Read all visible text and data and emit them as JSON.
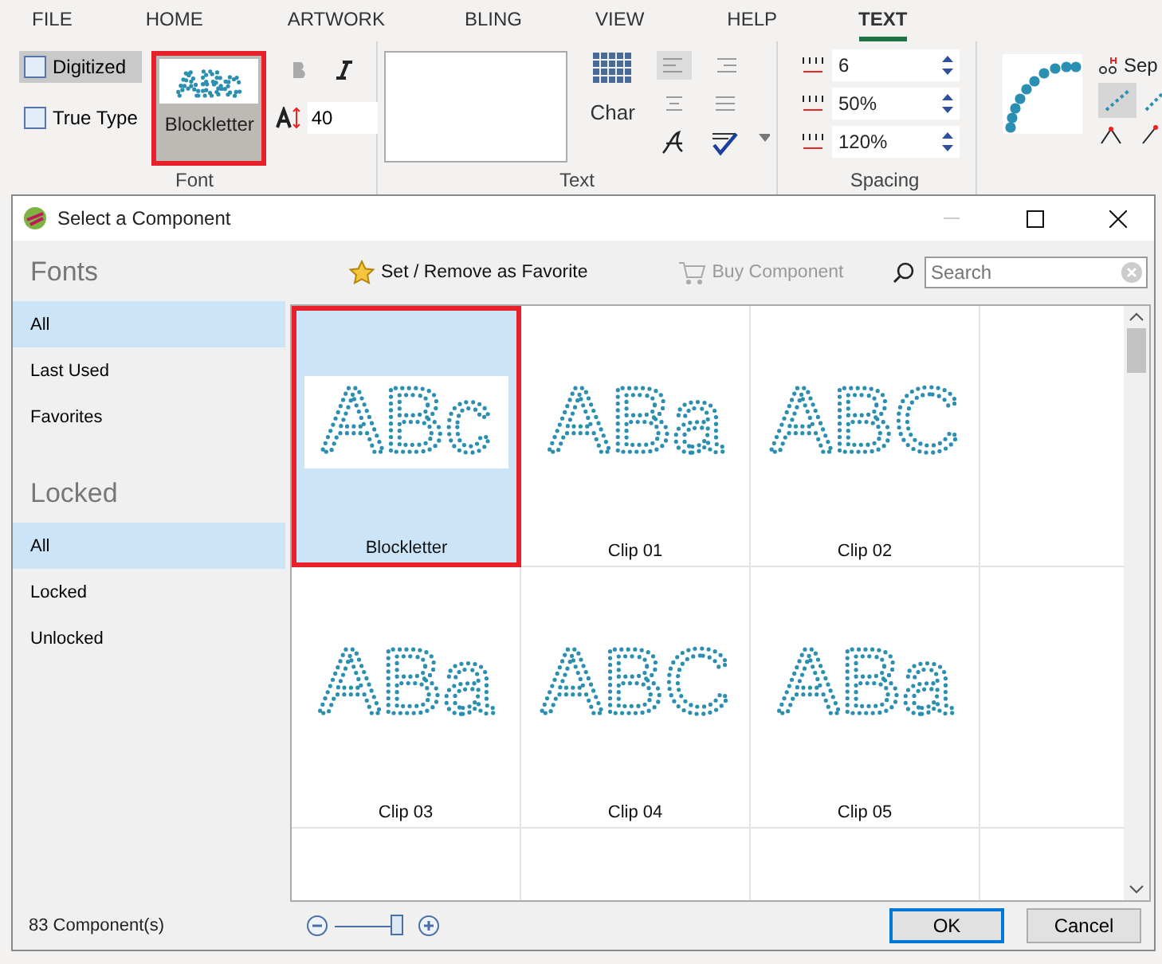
{
  "ribbon": {
    "tabs": [
      {
        "label": "FILE",
        "selected": false
      },
      {
        "label": "HOME",
        "selected": false
      },
      {
        "label": "ARTWORK",
        "selected": false
      },
      {
        "label": "BLING",
        "selected": false
      },
      {
        "label": "VIEW",
        "selected": false
      },
      {
        "label": "HELP",
        "selected": false
      },
      {
        "label": "TEXT",
        "selected": true
      }
    ],
    "font_group": {
      "label": "Font",
      "modes": [
        {
          "label": "Digitized",
          "selected": true
        },
        {
          "label": "True Type",
          "selected": false
        }
      ],
      "font_button": {
        "label": "Blockletter",
        "preview": "ABc",
        "highlighted": true
      },
      "size": "40"
    },
    "text_group": {
      "label": "Text",
      "char_label": "Char"
    },
    "spacing_group": {
      "label": "Spacing",
      "fields": [
        {
          "value": "6"
        },
        {
          "value": "50%"
        },
        {
          "value": "120%"
        }
      ]
    },
    "bling_group": {
      "label": "Sep"
    }
  },
  "dialog": {
    "title": "Select a Component",
    "sidebar": [
      {
        "heading": "Fonts",
        "items": [
          {
            "label": "All",
            "selected": true
          },
          {
            "label": "Last Used",
            "selected": false
          },
          {
            "label": "Favorites",
            "selected": false
          }
        ]
      },
      {
        "heading": "Locked",
        "items": [
          {
            "label": "All",
            "selected": true
          },
          {
            "label": "Locked",
            "selected": false
          },
          {
            "label": "Unlocked",
            "selected": false
          }
        ]
      }
    ],
    "toolbar": {
      "favorite": "Set / Remove as Favorite",
      "buy": "Buy Component",
      "buy_disabled": true,
      "search_placeholder": "Search"
    },
    "components": [
      {
        "name": "Blockletter",
        "preview": "ABc",
        "selected": true,
        "highlighted": true
      },
      {
        "name": "Clip 01",
        "preview": "ABa",
        "selected": false,
        "highlighted": false
      },
      {
        "name": "Clip 02",
        "preview": "ABC",
        "selected": false,
        "highlighted": false
      },
      {
        "name": "Clip 03",
        "preview": "ABa",
        "selected": false,
        "highlighted": false
      },
      {
        "name": "Clip 04",
        "preview": "ABC",
        "selected": false,
        "highlighted": false
      },
      {
        "name": "Clip 05",
        "preview": "ABa",
        "selected": false,
        "highlighted": false
      }
    ],
    "status": "83 Component(s)",
    "zoom": {
      "level": 0.9
    },
    "buttons": [
      "OK",
      "Cancel"
    ]
  }
}
